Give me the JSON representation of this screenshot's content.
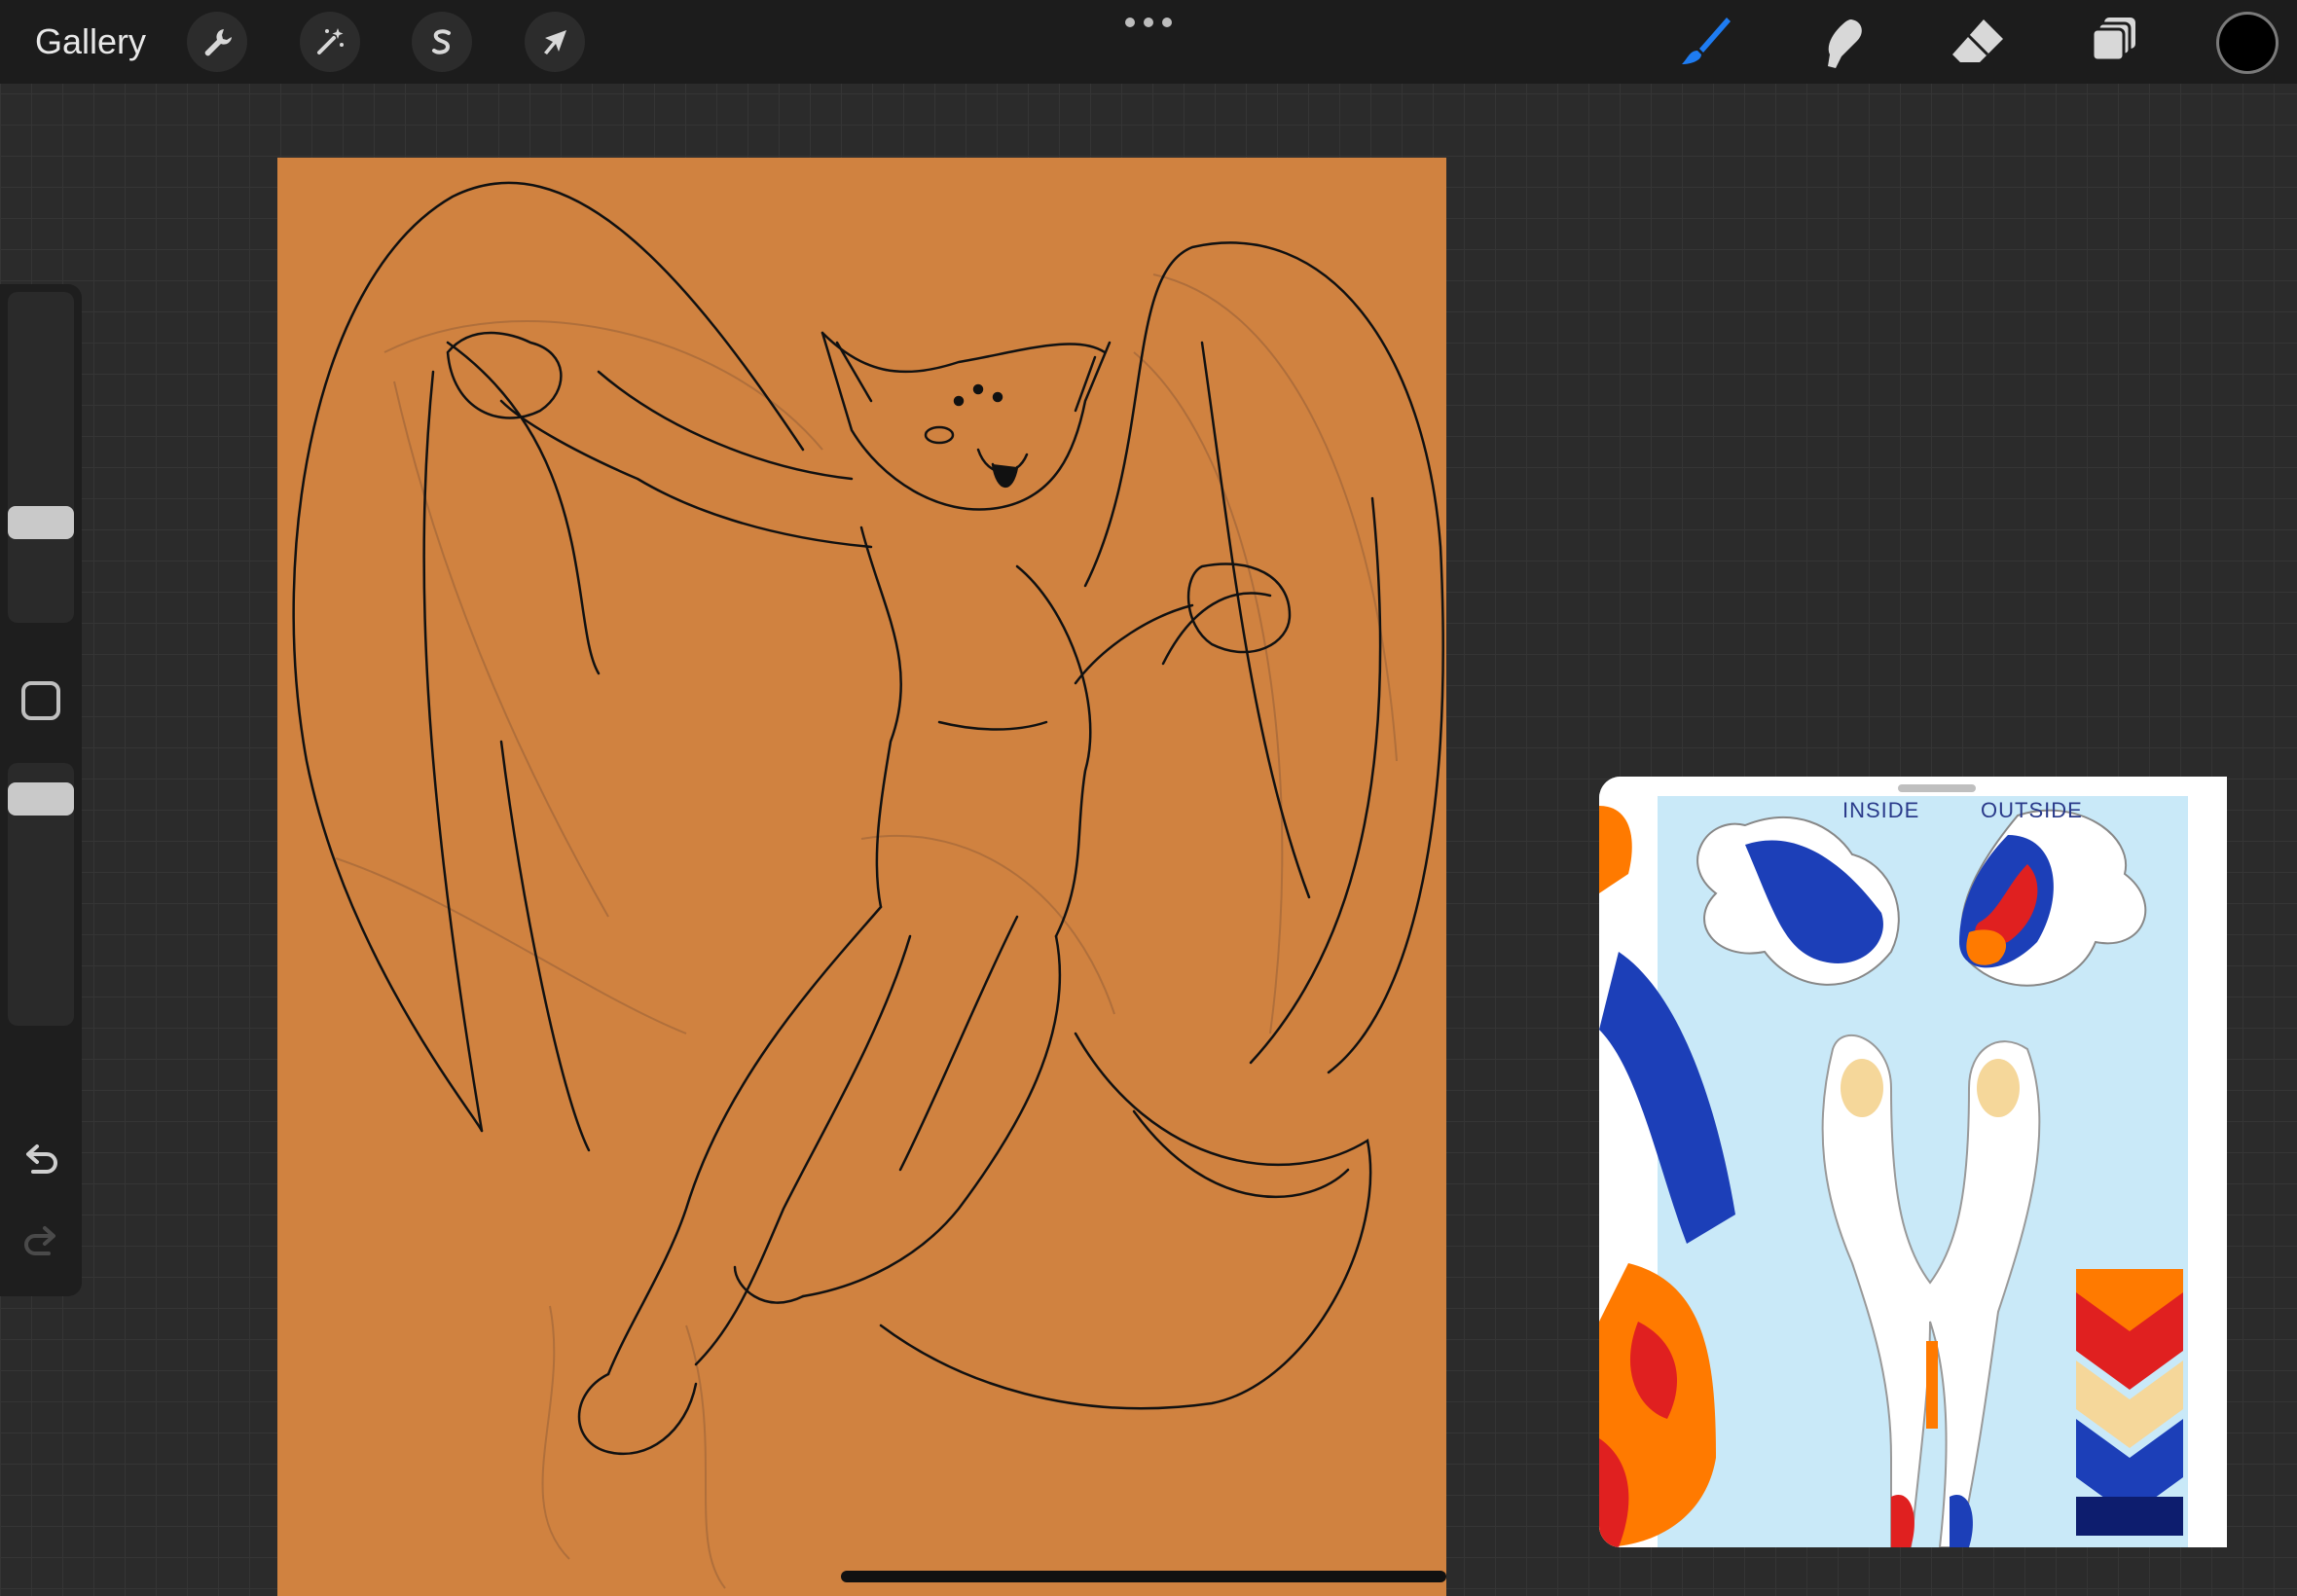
{
  "topbar": {
    "gallery_label": "Gallery",
    "left_tools": [
      "wrench-icon",
      "magic-wand-icon",
      "selection-s-icon",
      "transform-arrow-icon"
    ],
    "more_icon": "more-dots-icon",
    "right_tools": [
      "brush-icon",
      "smudge-icon",
      "eraser-icon",
      "layers-icon"
    ],
    "current_color": "#000000",
    "active_tool_color": "#1e7cf2"
  },
  "sidebar": {
    "brush_size_level": 0.65,
    "opacity_level": 0.15,
    "modify_button_icon": "square-icon",
    "undo_icon": "undo-icon",
    "redo_icon": "redo-icon"
  },
  "canvas": {
    "background_color": "#d08240",
    "sketch_stroke_color": "#111111"
  },
  "reference": {
    "label_inside": "INSIDE",
    "label_outside": "OUTSIDE",
    "palette": [
      "#ff7a00",
      "#e02020",
      "#f5d79a",
      "#1c3fb8",
      "#0d1d6e"
    ]
  }
}
